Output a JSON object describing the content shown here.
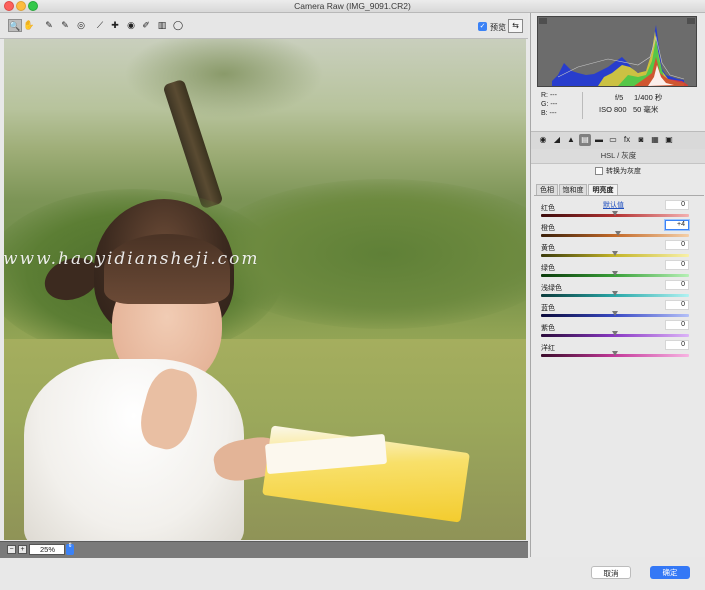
{
  "window": {
    "title": "Camera Raw (IMG_9091.CR2)"
  },
  "toolbar": {
    "tools": [
      {
        "name": "zoom-tool",
        "icon": "magnifier-icon",
        "glyph": "🔍"
      },
      {
        "name": "hand-tool",
        "icon": "hand-icon",
        "glyph": "✋"
      },
      {
        "name": "white-balance-tool",
        "icon": "eyedropper-icon",
        "glyph": "✎"
      },
      {
        "name": "color-sampler-tool",
        "icon": "sampler-icon",
        "glyph": "✎"
      },
      {
        "name": "targeted-adjustment-tool",
        "icon": "target-icon",
        "glyph": "◎"
      },
      {
        "name": "straighten-tool",
        "icon": "straighten-icon",
        "glyph": "⟋"
      },
      {
        "name": "spot-removal-tool",
        "icon": "spot-icon",
        "glyph": "✚"
      },
      {
        "name": "red-eye-tool",
        "icon": "eye-icon",
        "glyph": "◉"
      },
      {
        "name": "adjustment-brush-tool",
        "icon": "brush-icon",
        "glyph": "✐"
      },
      {
        "name": "graduated-filter-tool",
        "icon": "gradient-icon",
        "glyph": "▥"
      },
      {
        "name": "radial-filter-tool",
        "icon": "radial-icon",
        "glyph": "◯"
      }
    ],
    "preview_label": "预览",
    "preview_checked": "✓",
    "toggle_glyph": "⇆"
  },
  "watermark": "www.haoyidiansheji.com",
  "bottombar": {
    "zoom_minus": "−",
    "zoom_plus": "+",
    "zoom_value": "25%",
    "zoom_stepper": "⇕"
  },
  "readout": {
    "r": "R:  ---",
    "g": "G:  ---",
    "b": "B:  ---",
    "aperture": "f/5",
    "shutter": "1/400 秒",
    "iso": "ISO 800",
    "focal": "50 毫米"
  },
  "panel_tabs": [
    {
      "name": "tab-basic",
      "glyph": "◉"
    },
    {
      "name": "tab-tone-curve",
      "glyph": "◢"
    },
    {
      "name": "tab-detail",
      "glyph": "▲"
    },
    {
      "name": "tab-hsl",
      "glyph": "▤"
    },
    {
      "name": "tab-split-toning",
      "glyph": "▬"
    },
    {
      "name": "tab-lens",
      "glyph": "▭"
    },
    {
      "name": "tab-effects",
      "glyph": "fx"
    },
    {
      "name": "tab-camera-calibration",
      "glyph": "◙"
    },
    {
      "name": "tab-presets",
      "glyph": "▦"
    },
    {
      "name": "tab-snapshots",
      "glyph": "▣"
    }
  ],
  "hsl": {
    "header": "HSL / 灰度",
    "grayscale_label": "转换为灰度",
    "subtabs": [
      "色相",
      "饱和度",
      "明亮度"
    ],
    "active_subtab": 2,
    "default_link": "默认值",
    "sliders": [
      {
        "label": "红色",
        "value": "0",
        "level": 0.5,
        "gradient": "linear-gradient(90deg,#3a0a0a,#b33333,#f4b0b0)"
      },
      {
        "label": "橙色",
        "value": "+4",
        "level": 0.52,
        "gradient": "linear-gradient(90deg,#3a200a,#c36a2a,#f4cfa8)",
        "focused": true
      },
      {
        "label": "黄色",
        "value": "0",
        "level": 0.5,
        "gradient": "linear-gradient(90deg,#3a3a0a,#c4b52a,#f8f0a8)"
      },
      {
        "label": "绿色",
        "value": "0",
        "level": 0.5,
        "gradient": "linear-gradient(90deg,#0a3a0a,#3aa03a,#b6f0b6)"
      },
      {
        "label": "浅绿色",
        "value": "0",
        "level": 0.5,
        "gradient": "linear-gradient(90deg,#0a3a3a,#2aa8a8,#b0f2f2)"
      },
      {
        "label": "蓝色",
        "value": "0",
        "level": 0.5,
        "gradient": "linear-gradient(90deg,#0a0a3a,#3a4ac4,#b4c0f8)"
      },
      {
        "label": "紫色",
        "value": "0",
        "level": 0.5,
        "gradient": "linear-gradient(90deg,#2a0a3a,#8a3ac4,#dcb4f8)"
      },
      {
        "label": "洋红",
        "value": "0",
        "level": 0.5,
        "gradient": "linear-gradient(90deg,#3a0a2a,#c43a9a,#f8b4e2)"
      }
    ]
  },
  "buttons": {
    "cancel": "取消",
    "ok": "确定"
  }
}
